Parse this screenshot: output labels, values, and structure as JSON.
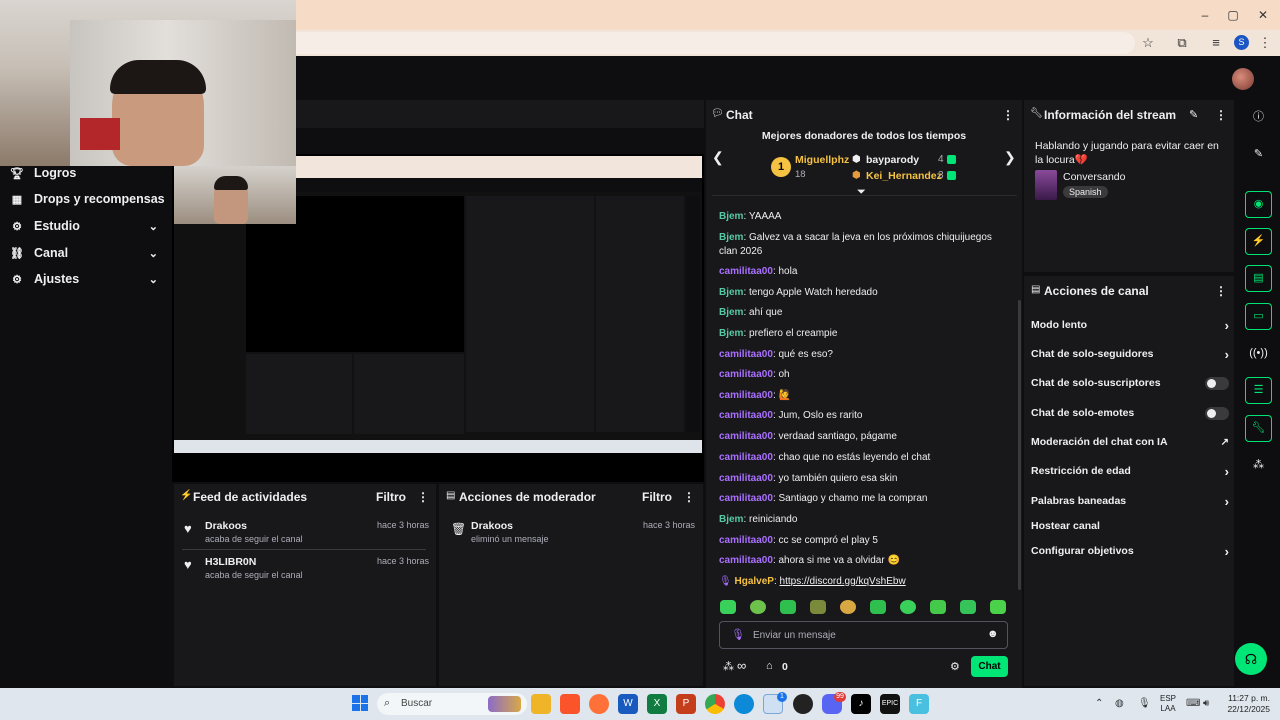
{
  "browser": {
    "window_controls": [
      "–",
      "▢",
      "✕"
    ],
    "profile_initial": "S"
  },
  "nav": {
    "items": [
      {
        "label": "Logros",
        "icon": "trophy-icon"
      },
      {
        "label": "Drops y recompensas",
        "icon": "gift-icon"
      },
      {
        "label": "Estudio",
        "icon": "studio-icon",
        "expandable": true
      },
      {
        "label": "Canal",
        "icon": "channel-icon",
        "expandable": true
      },
      {
        "label": "Ajustes",
        "icon": "gear-icon",
        "expandable": true
      }
    ]
  },
  "feed": {
    "title": "Feed de actividades",
    "filter": "Filtro",
    "items": [
      {
        "name": "Drakoos",
        "action": "acaba de seguir el canal",
        "time": "hace 3 horas"
      },
      {
        "name": "H3LIBR0N",
        "action": "acaba de seguir el canal",
        "time": "hace 3 horas"
      }
    ]
  },
  "mod_actions": {
    "title": "Acciones de moderador",
    "filter": "Filtro",
    "items": [
      {
        "name": "Drakoos",
        "action": "eliminó un mensaje",
        "time": "hace 3 horas"
      }
    ]
  },
  "chat": {
    "title": "Chat",
    "donors_title": "Mejores donadores de todos los tiempos",
    "donors": [
      {
        "rank": "1",
        "name": "Miguellphz",
        "amount": "18"
      },
      {
        "name": "bayparody",
        "amount": "4"
      },
      {
        "name": "Kei_Hernandez",
        "amount": "3"
      }
    ],
    "messages": [
      {
        "user": "Bjem",
        "color": "green",
        "text": "YAAAA"
      },
      {
        "user": "Bjem",
        "color": "green",
        "text": "Galvez va a sacar la jeva en los próximos chiquijuegos clan 2026"
      },
      {
        "user": "camilitaa00",
        "color": "purple",
        "text": "hola"
      },
      {
        "user": "Bjem",
        "color": "green",
        "text": "tengo Apple Watch heredado"
      },
      {
        "user": "Bjem",
        "color": "green",
        "text": "ahí que"
      },
      {
        "user": "Bjem",
        "color": "green",
        "text": "prefiero el creampie"
      },
      {
        "user": "camilitaa00",
        "color": "purple",
        "text": "qué es eso?"
      },
      {
        "user": "camilitaa00",
        "color": "purple",
        "text": "oh"
      },
      {
        "user": "camilitaa00",
        "color": "purple",
        "text": "🙋"
      },
      {
        "user": "camilitaa00",
        "color": "purple",
        "text": "Jum, Oslo es rarito"
      },
      {
        "user": "camilitaa00",
        "color": "purple",
        "text": "verdaad santiago, págame"
      },
      {
        "user": "camilitaa00",
        "color": "purple",
        "text": "chao que no estás leyendo el chat"
      },
      {
        "user": "camilitaa00",
        "color": "purple",
        "text": "yo también quiero esa skin"
      },
      {
        "user": "camilitaa00",
        "color": "purple",
        "text": "Santiago y chamo me la compran"
      },
      {
        "user": "Bjem",
        "color": "green",
        "text": "reiniciando"
      },
      {
        "user": "camilitaa00",
        "color": "purple",
        "text": "cc se compró el play 5"
      },
      {
        "user": "camilitaa00",
        "color": "purple",
        "text": "ahora si me va a olvidar 😊"
      },
      {
        "user": "HgalveP",
        "color": "yellow",
        "text": "https://discord.gg/kqVshEbw"
      }
    ],
    "input_placeholder": "Enviar un mensaje",
    "points": "∞",
    "store_count": "0",
    "send_label": "Chat"
  },
  "stream_info": {
    "title": "Información del stream",
    "stream_title": "Hablando y jugando para evitar caer en la locura💔",
    "category": "Conversando",
    "language": "Spanish"
  },
  "channel_actions": {
    "title": "Acciones de canal",
    "items": [
      {
        "label": "Modo lento",
        "control": "chevron"
      },
      {
        "label": "Chat de solo-seguidores",
        "control": "chevron"
      },
      {
        "label": "Chat de solo-suscriptores",
        "control": "toggle"
      },
      {
        "label": "Chat de solo-emotes",
        "control": "toggle"
      },
      {
        "label": "Moderación del chat con IA",
        "control": "external"
      },
      {
        "label": "Restricción de edad",
        "control": "chevron"
      },
      {
        "label": "Palabras baneadas",
        "control": "chevron"
      },
      {
        "label": "Hostear canal",
        "control": "none"
      },
      {
        "label": "Configurar objetivos",
        "control": "chevron"
      }
    ]
  },
  "taskbar": {
    "search_placeholder": "Buscar",
    "lang": "ESP",
    "region": "LAA",
    "time": "11:27 p. m.",
    "date": "22/12/2025",
    "badge_chrome": "1",
    "badge_discord": "99"
  },
  "colors": {
    "accent_green": "#00e676",
    "twitch_bg": "#0e0e10",
    "panel_bg": "#18181b"
  }
}
